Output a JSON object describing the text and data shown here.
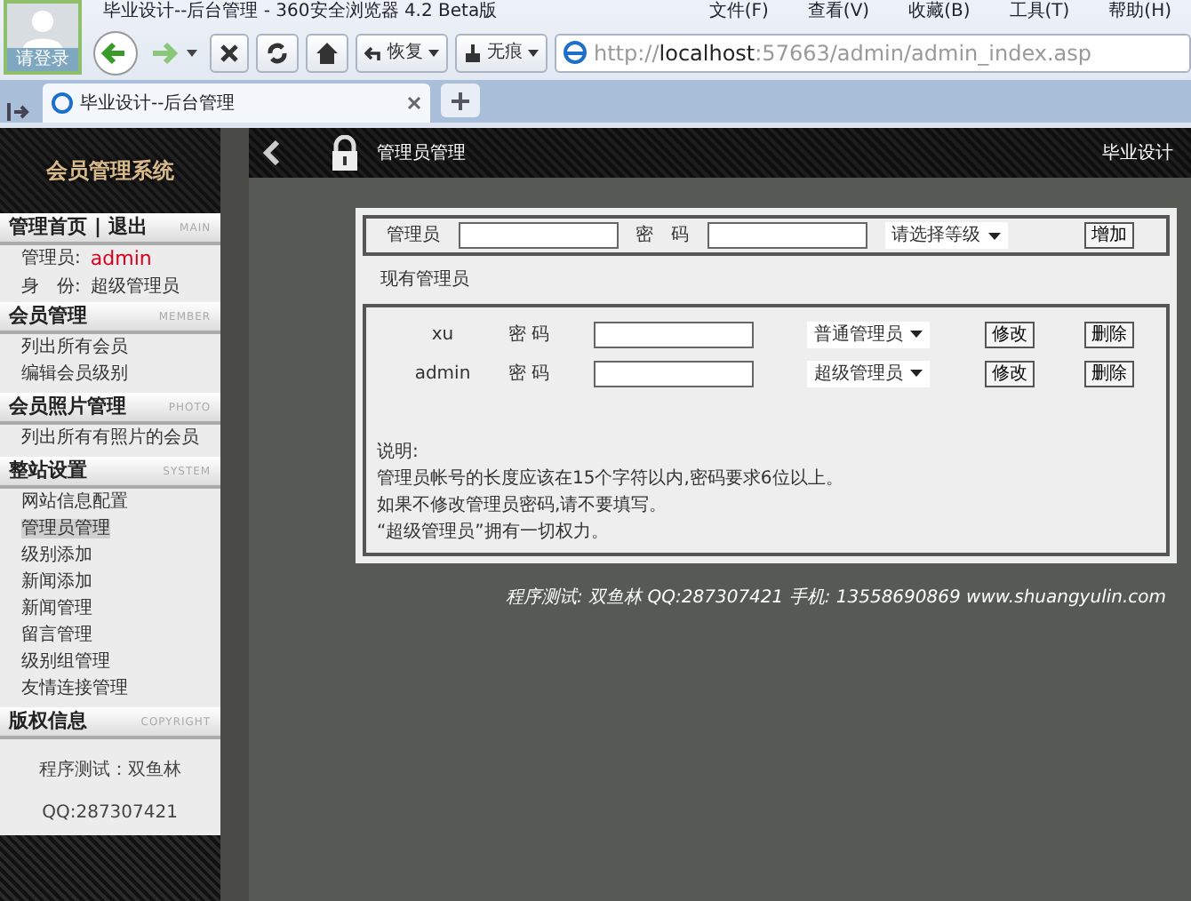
{
  "browser": {
    "title": "毕业设计--后台管理 - 360安全浏览器 4.2 Beta版",
    "avatar_label": "请登录",
    "menu": [
      "文件(F)",
      "查看(V)",
      "收藏(B)",
      "工具(T)",
      "帮助(H)"
    ],
    "toolbar": {
      "restore": "恢复",
      "incognito": "无痕"
    },
    "url": "http://**localhost**:57663/admin/admin_index.asp",
    "tabs": [
      {
        "label": "毕业设计--后台管理",
        "selected": true
      }
    ]
  },
  "sidebar": {
    "logo": "会员管理系统",
    "sections": [
      {
        "kind": "info",
        "title_links": [
          "管理首页",
          "退出"
        ],
        "separator": "|",
        "tag": "MAIN",
        "rows": [
          {
            "label": "管理员:",
            "value": "admin",
            "highlight": true
          },
          {
            "label": "身　份:",
            "value": "超级管理员",
            "highlight": false
          }
        ]
      },
      {
        "kind": "links",
        "title": "会员管理",
        "tag": "MEMBER",
        "items": [
          {
            "label": "列出所有会员",
            "selected": false
          },
          {
            "label": "编辑会员级别",
            "selected": false
          }
        ]
      },
      {
        "kind": "links",
        "title": "会员照片管理",
        "tag": "PHOTO",
        "items": [
          {
            "label": "列出所有有照片的会员",
            "selected": false
          }
        ]
      },
      {
        "kind": "links",
        "title": "整站设置",
        "tag": "SYSTEM",
        "items": [
          {
            "label": "网站信息配置",
            "selected": false
          },
          {
            "label": "管理员管理",
            "selected": true
          },
          {
            "label": "级别添加",
            "selected": false
          },
          {
            "label": "新闻添加",
            "selected": false
          },
          {
            "label": "新闻管理",
            "selected": false
          },
          {
            "label": "留言管理",
            "selected": false
          },
          {
            "label": "级别组管理",
            "selected": false
          },
          {
            "label": "友情连接管理",
            "selected": false
          }
        ]
      },
      {
        "kind": "copyright",
        "title": "版权信息",
        "tag": "COPYRIGHT",
        "lines": [
          "程序测试：双鱼林",
          "QQ:287307421"
        ]
      }
    ]
  },
  "header": {
    "title": "管理员管理",
    "right": "毕业设计"
  },
  "add_form": {
    "user_label": "管理员",
    "password_label": "密　码",
    "level": "请选择等级",
    "button": "增加"
  },
  "existing_title": "现有管理员",
  "admins": [
    {
      "name": "xu",
      "password_label": "密 码",
      "level": "普通管理员",
      "edit": "修改",
      "delete": "删除"
    },
    {
      "name": "admin",
      "password_label": "密 码",
      "level": "超级管理员",
      "edit": "修改",
      "delete": "删除"
    }
  ],
  "notes": [
    "说明:",
    "管理员帐号的长度应该在15个字符以内,密码要求6位以上。",
    "如果不修改管理员密码,请不要填写。",
    "“超级管理员”拥有一切权力。"
  ],
  "footer": "程序测试: 双鱼林  QQ:287307421  手机: 13558690869 www.shuangyulin.com"
}
